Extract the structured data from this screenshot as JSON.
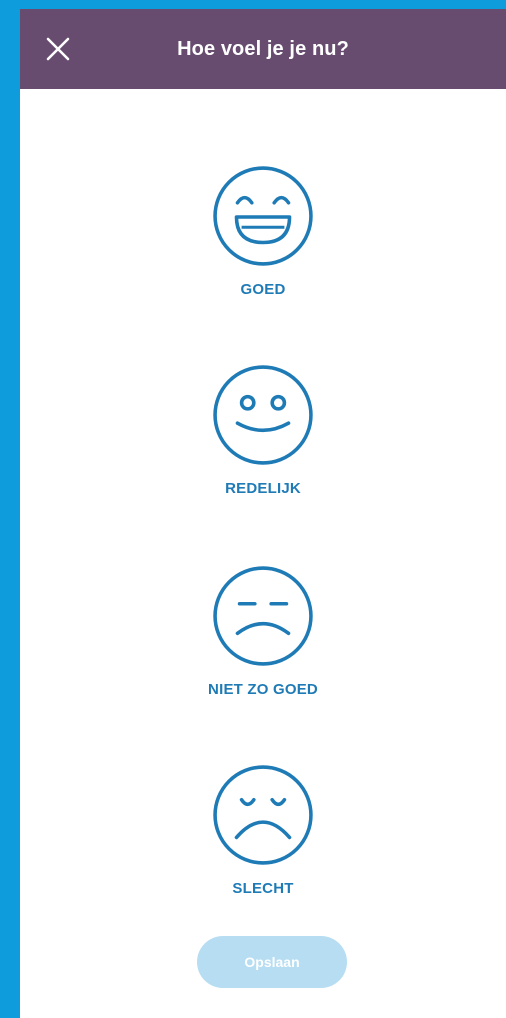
{
  "header": {
    "title": "Hoe voel je je nu?",
    "close_icon": "close-icon"
  },
  "moods": [
    {
      "label": "GOED",
      "icon": "smile-big-icon"
    },
    {
      "label": "REDELIJK",
      "icon": "smile-icon"
    },
    {
      "label": "NIET ZO GOED",
      "icon": "frown-slight-icon"
    },
    {
      "label": "SLECHT",
      "icon": "sad-icon"
    }
  ],
  "actions": {
    "save_label": "Opslaan"
  },
  "colors": {
    "frame": "#0E9CDD",
    "header": "#684C70",
    "accent": "#1F7BB6",
    "save_disabled": "#B6DDF2"
  }
}
